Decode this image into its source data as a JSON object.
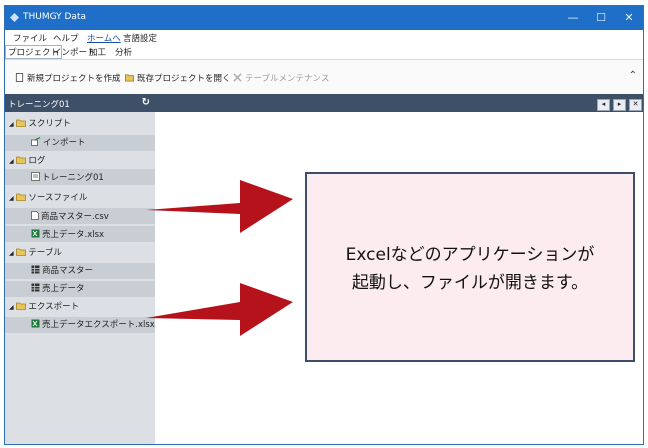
{
  "window": {
    "title": "THUMGY Data"
  },
  "menu": [
    "ファイル",
    "ヘルプ",
    "ホームへ",
    "言語設定"
  ],
  "ribbon_tabs": [
    "プロジェクト",
    "インポート",
    "加工",
    "分析"
  ],
  "ribbon": {
    "new_project": "新規プロジェクトを作成",
    "open_project": "既存プロジェクトを開く",
    "table_maintenance": "テーブルメンテナンス"
  },
  "sidebar": {
    "header": "トレーニング01",
    "tree": [
      {
        "label": "スクリプト",
        "icon": "folder-icon"
      },
      {
        "label": "インポート",
        "icon": "import-icon"
      },
      {
        "label": "ログ",
        "icon": "folder-icon"
      },
      {
        "label": "トレーニング01",
        "icon": "log-icon"
      },
      {
        "label": "ソースファイル",
        "icon": "folder-icon"
      },
      {
        "label": "商品マスター.csv",
        "icon": "file-icon"
      },
      {
        "label": "売上データ.xlsx",
        "icon": "excel-icon"
      },
      {
        "label": "テーブル",
        "icon": "folder-icon"
      },
      {
        "label": "商品マスター",
        "icon": "table-icon"
      },
      {
        "label": "売上データ",
        "icon": "table-icon"
      },
      {
        "label": "エクスポート",
        "icon": "folder-icon"
      },
      {
        "label": "売上データエクスポート.xlsx",
        "icon": "excel-icon"
      }
    ]
  },
  "callout": {
    "line1": "Excelなどのアプリケーションが",
    "line2": "起動し、ファイルが開きます。"
  },
  "colors": {
    "titlebar": "#1f6fc8",
    "panel_header": "#3e4f68",
    "arrow": "#b5121b",
    "callout_bg": "#fcecf0"
  }
}
